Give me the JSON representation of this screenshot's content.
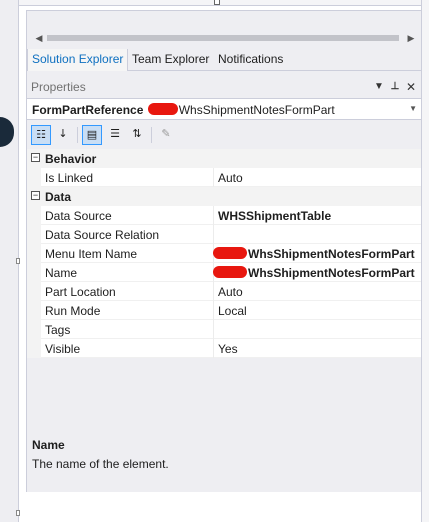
{
  "tabs": [
    {
      "label": "Solution Explorer"
    },
    {
      "label": "Team Explorer"
    },
    {
      "label": "Notifications"
    }
  ],
  "properties": {
    "title": "Properties",
    "object_name_prefix": "FormPartReference ",
    "object_name_suffix": "WhsShipmentNotesFormPart"
  },
  "categories": [
    {
      "label": "Behavior"
    },
    {
      "label": "Data"
    }
  ],
  "rows": [
    {
      "label": "Is Linked",
      "value": "Auto"
    },
    {
      "label": "Data Source",
      "value": "WHSShipmentTable"
    },
    {
      "label": "Data Source Relation",
      "value": ""
    },
    {
      "label": "Menu Item Name",
      "value": "WhsShipmentNotesFormPart"
    },
    {
      "label": "Name",
      "value": "WhsShipmentNotesFormPart"
    },
    {
      "label": "Part Location",
      "value": "Auto"
    },
    {
      "label": "Run Mode",
      "value": "Local"
    },
    {
      "label": "Tags",
      "value": ""
    },
    {
      "label": "Visible",
      "value": "Yes"
    }
  ],
  "description": {
    "name": "Name",
    "text": "The name of the element."
  },
  "icons": {
    "pin": "pin-icon",
    "close": "close-icon",
    "dropdown": "chevron-down-icon"
  }
}
